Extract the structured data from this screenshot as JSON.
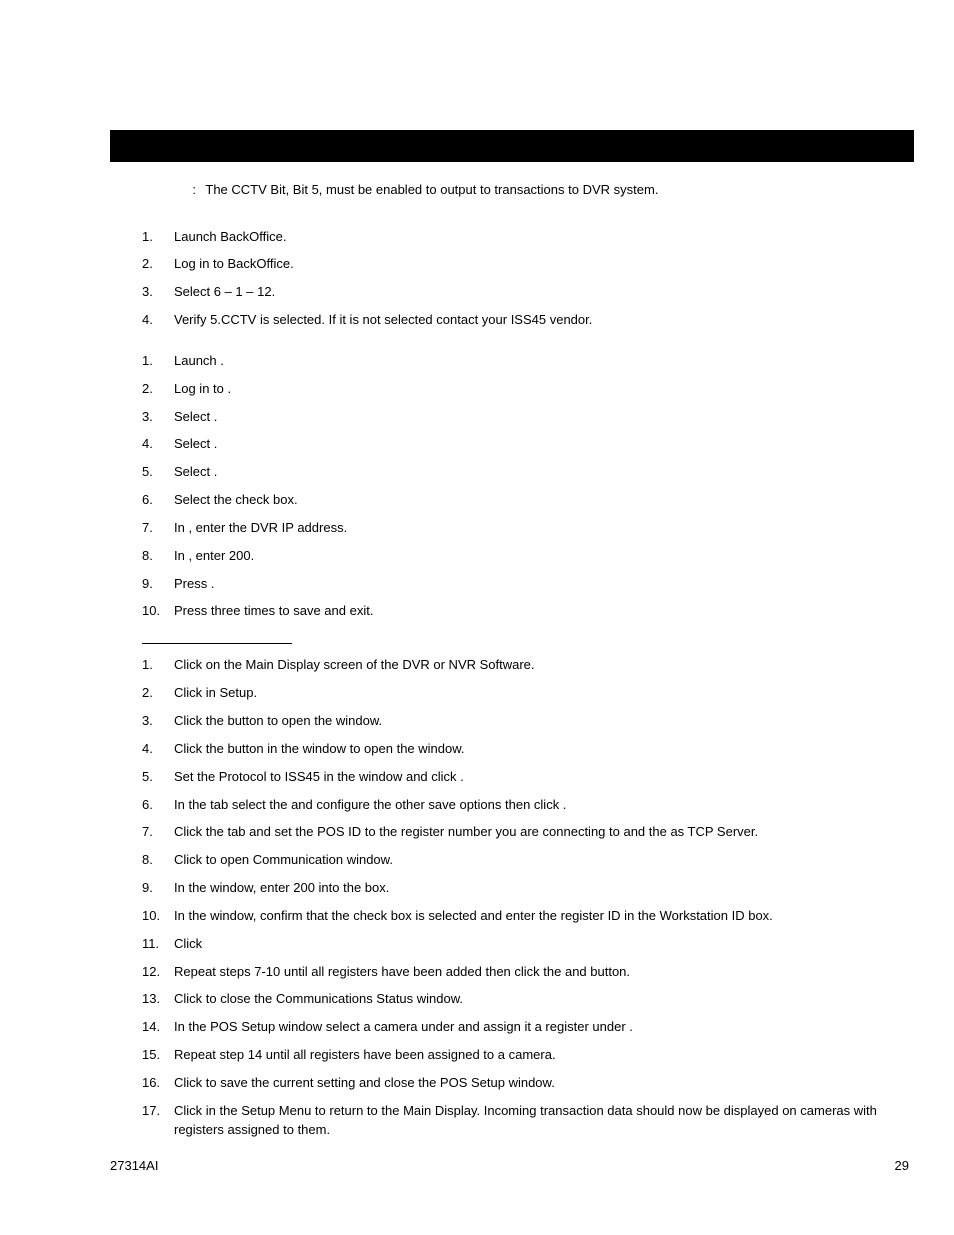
{
  "note": {
    "colon": ":",
    "text": "The CCTV Bit, Bit 5, must be enabled to output to transactions to DVR system."
  },
  "sectionA": {
    "steps": [
      {
        "n": "1.",
        "t": "Launch BackOffice."
      },
      {
        "n": "2.",
        "t": "Log in to BackOffice."
      },
      {
        "n": "3.",
        "t": "Select 6 – 1 – 12."
      },
      {
        "n": "4.",
        "t": "Verify 5.CCTV is selected.  If it is not selected contact your ISS45 vendor."
      }
    ]
  },
  "sectionB": {
    "steps": [
      {
        "n": "1.",
        "t": "Launch             ."
      },
      {
        "n": "2.",
        "t": "Log in to                ."
      },
      {
        "n": "3.",
        "t": "Select                                                       ."
      },
      {
        "n": "4.",
        "t": "Select                                           ."
      },
      {
        "n": "5.",
        "t": "Select                             ."
      },
      {
        "n": "6.",
        "t": "Select the                                   check box."
      },
      {
        "n": "7.",
        "t": "In                                             , enter the DVR IP address."
      },
      {
        "n": "8.",
        "t": "In                                , enter 200."
      },
      {
        "n": "9.",
        "t": "Press      ."
      },
      {
        "n": "10.",
        "t": "Press          three times to save and exit."
      }
    ]
  },
  "sectionC": {
    "steps": [
      {
        "n": "1.",
        "t": "Click            on the Main Display screen of the DVR or NVR Software."
      },
      {
        "n": "2.",
        "t": "Click            in Setup."
      },
      {
        "n": "3.",
        "t": "Click the                    button to open the                    window."
      },
      {
        "n": "4.",
        "t": "Click the                              button in the                          window to open the                                       window."
      },
      {
        "n": "5.",
        "t": "Set the Protocol to ISS45 in the                                               window and click            ."
      },
      {
        "n": "6.",
        "t": "In the          tab select the                              and configure the other save options then click            ."
      },
      {
        "n": "7.",
        "t": "Click the                              tab and set the POS ID to the register number you are connecting to and the            as TCP Server."
      },
      {
        "n": "8.",
        "t": "Click          to open                    Communication window."
      },
      {
        "n": "9.",
        "t": "In the                                               window, enter 200 into the                    box."
      },
      {
        "n": "10.",
        "t": "In the                                               window, confirm that the                                      check box is selected and enter the register ID in the Workstation ID box."
      },
      {
        "n": "11.",
        "t": "Click"
      },
      {
        "n": "12.",
        "t": "Repeat steps 7-10 until all registers have been added then click the            and            button."
      },
      {
        "n": "13.",
        "t": "Click          to close the Communications Status window."
      },
      {
        "n": "14.",
        "t": "In the POS Setup window select a camera under                    and assign it a register under            ."
      },
      {
        "n": "15.",
        "t": "Repeat step 14 until all registers have been assigned to a camera."
      },
      {
        "n": "16.",
        "t": "Click          to save the current setting and close the POS Setup window."
      },
      {
        "n": "17.",
        "t": "Click          in the Setup Menu to return to the Main Display.  Incoming transaction data should now be displayed on cameras with registers assigned to them."
      }
    ]
  },
  "footer": {
    "left": "27314AI",
    "right": "29"
  }
}
